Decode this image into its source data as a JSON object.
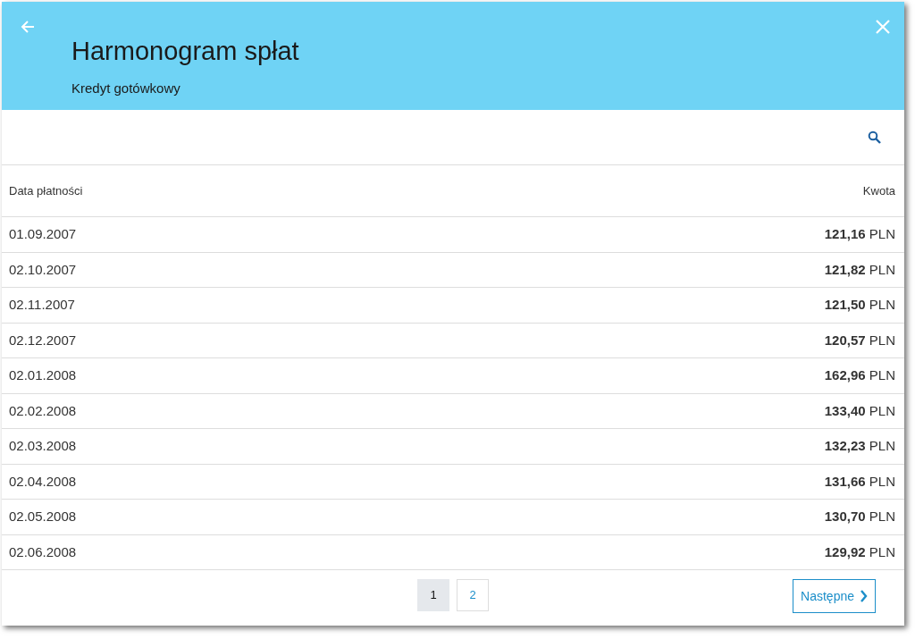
{
  "header": {
    "title": "Harmonogram spłat",
    "subtitle": "Kredyt gotówkowy"
  },
  "table": {
    "columns": [
      "Data płatności",
      "Kwota"
    ],
    "rows": [
      {
        "date": "01.09.2007",
        "amount": "**121,16** PLN"
      },
      {
        "date": "02.10.2007",
        "amount": "**121,82** PLN"
      },
      {
        "date": "02.11.2007",
        "amount": "**121,50** PLN"
      },
      {
        "date": "02.12.2007",
        "amount": "**120,57** PLN"
      },
      {
        "date": "02.01.2008",
        "amount": "**162,96** PLN"
      },
      {
        "date": "02.02.2008",
        "amount": "**133,40** PLN"
      },
      {
        "date": "02.03.2008",
        "amount": "**132,23** PLN"
      },
      {
        "date": "02.04.2008",
        "amount": "**131,66** PLN"
      },
      {
        "date": "02.05.2008",
        "amount": "**130,70** PLN"
      },
      {
        "date": "02.06.2008",
        "amount": "**129,92** PLN"
      }
    ]
  },
  "pagination": {
    "pages": [
      {
        "label": "1",
        "selected": true
      },
      {
        "label": "2",
        "selected": false
      }
    ],
    "next": "Następne"
  }
}
